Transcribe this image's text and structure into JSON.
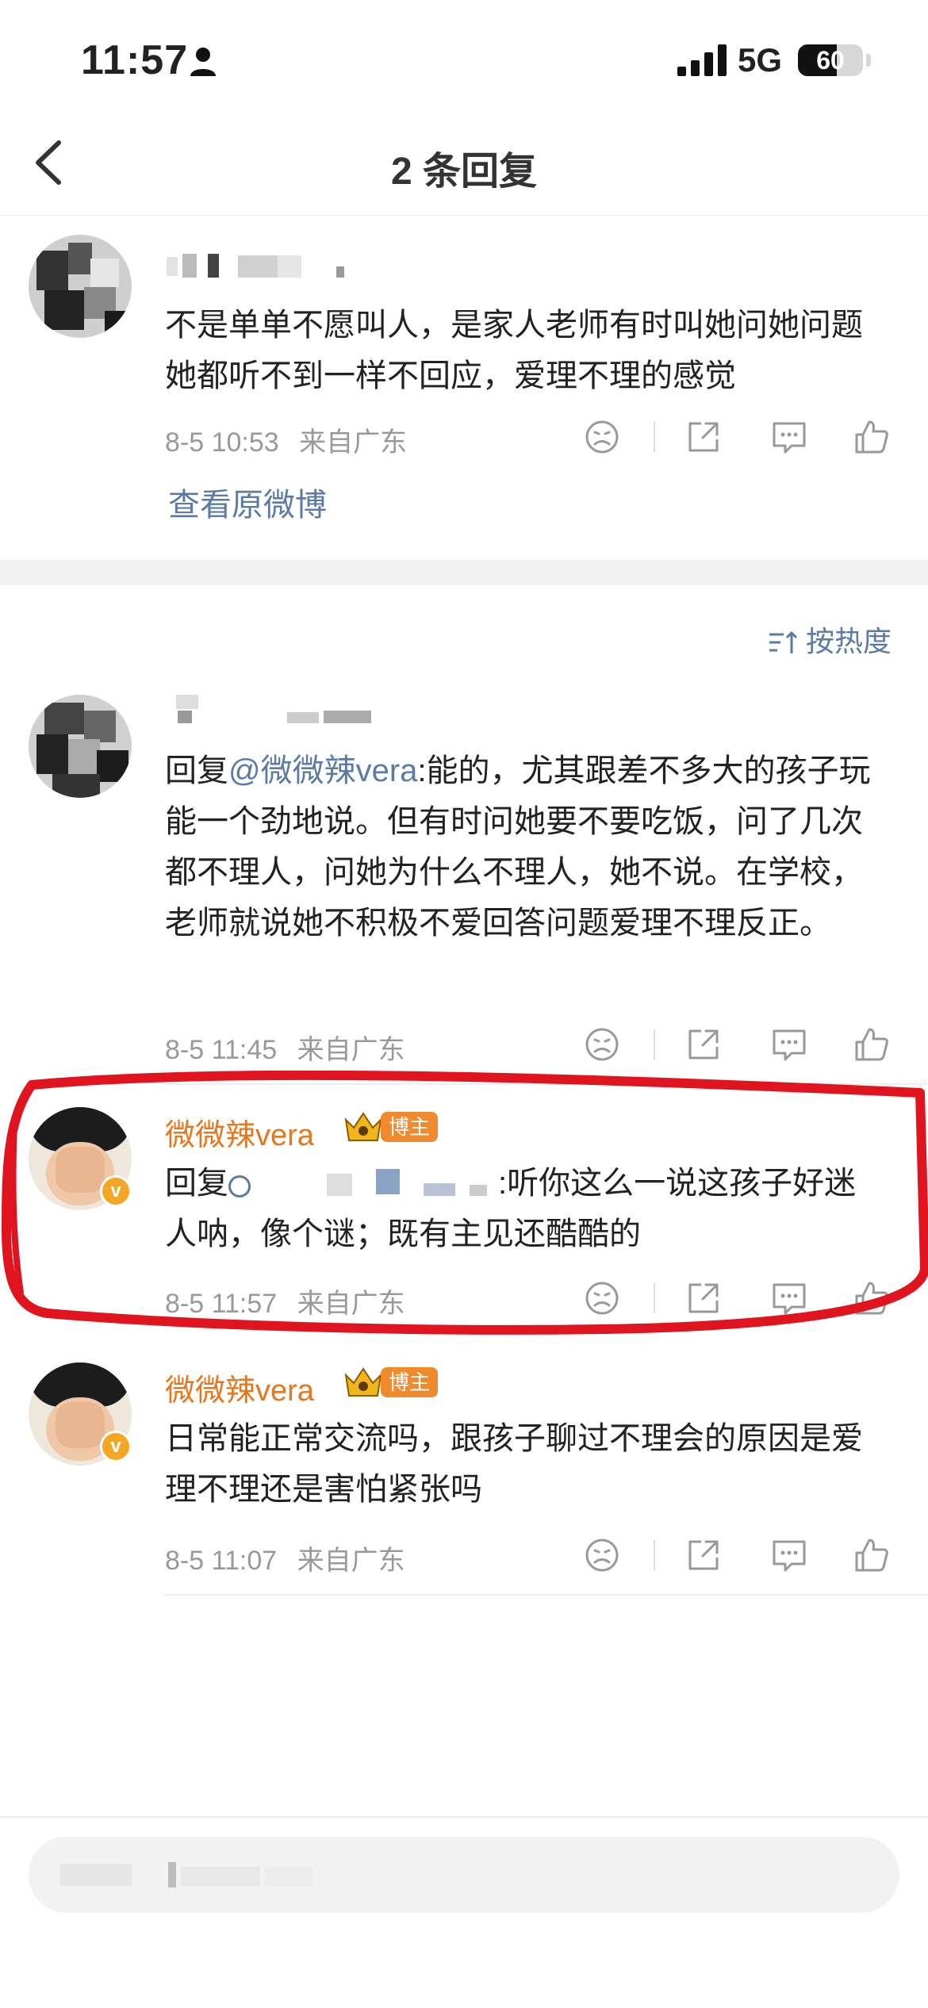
{
  "status_bar": {
    "time": "11:57",
    "network": "5G",
    "battery": "60",
    "battery_level": 0.6
  },
  "nav": {
    "title": "2 条回复",
    "back_icon": "chevron-left-icon"
  },
  "original_comment": {
    "text": "不是单单不愿叫人，是家人老师有时叫她问她问题她都听不到一样不回应，爱理不理的感觉",
    "time": "8-5 10:53",
    "location": "来自广东",
    "view_original": "查看原微博"
  },
  "sort": {
    "label": "按热度",
    "icon": "sort-icon"
  },
  "replies": [
    {
      "reply_prefix": "回复",
      "mention": "@微微辣vera",
      "text": ":能的，尤其跟差不多大的孩子玩能一个劲地说。但有时问她要不要吃饭，问了几次都不理人，问她为什么不理人，她不说。在学校，老师就说她不积极不爱回答问题爱理不理反正。",
      "time": "8-5 11:45",
      "location": "来自广东"
    },
    {
      "username": "微微辣vera",
      "badge": "博主",
      "reply_prefix": "回复",
      "text": ":听你这么一说这孩子好迷人呐，像个谜；既有主见还酷酷的",
      "time": "8-5 11:57",
      "location": "来自广东",
      "highlight_color": "#e0141e"
    },
    {
      "username": "微微辣vera",
      "badge": "博主",
      "text": "日常能正常交流吗，跟孩子聊过不理会的原因是爱理不理还是害怕紧张吗",
      "time": "8-5 11:07",
      "location": "来自广东"
    }
  ],
  "colors": {
    "username": "#e8761c",
    "link": "#5b7ba6",
    "meta": "#999999",
    "highlight": "#e0141e"
  }
}
